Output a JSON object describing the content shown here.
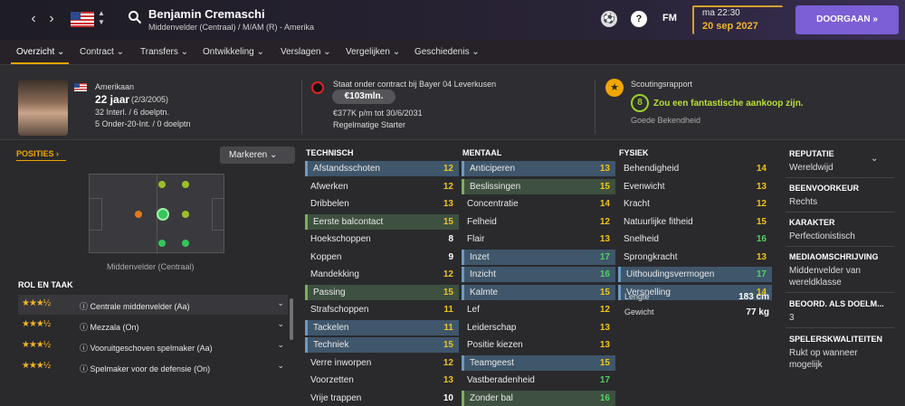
{
  "header": {
    "back_icon": "chevron-left-icon",
    "forward_icon": "chevron-right-icon",
    "player_name": "Benjamin Cremaschi",
    "player_sub": "Middenvelder (Centraal) / M/AM (R) - Amerika",
    "fm_label": "FM",
    "day_time": "ma 22:30",
    "date": "20 sep 2027",
    "continue_label": "DOORGAAN »",
    "help_label": "?"
  },
  "tabs": [
    "Overzicht ⌄",
    "Contract ⌄",
    "Transfers ⌄",
    "Ontwikkeling ⌄",
    "Verslagen ⌄",
    "Vergelijken ⌄",
    "Geschiedenis ⌄"
  ],
  "info": {
    "nationality": "Amerikaan",
    "age": "22 jaar",
    "dob": "(2/3/2005)",
    "caps": "32 Interl. / 6 doelptn.",
    "u20": "5 Onder-20-Int. / 0 doelptn",
    "contract_line": "Staat onder contract bij Bayer 04 Leverkusen",
    "value": "€103mln.",
    "wage": "€377K p/m tot 30/6/2031",
    "status": "Regelmatige Starter",
    "scout_title": "Scoutingsrapport",
    "scout_rating": "8",
    "scout_text": "Zou een fantastische aankoop zijn.",
    "scout_sub": "Goede Bekendheid"
  },
  "left": {
    "positions_label": "POSITIES ›",
    "mark_button": "Markeren ⌄",
    "pitch_caption": "Middenvelder (Centraal)",
    "role_header": "ROL EN TAAK",
    "roles": [
      {
        "stars": "★★★½",
        "name": "ⓘ Centrale middenvelder (Aa)"
      },
      {
        "stars": "★★★½",
        "name": "ⓘ Mezzala (On)"
      },
      {
        "stars": "★★★½",
        "name": "ⓘ Vooruitgeschoven spelmaker (Aa)"
      },
      {
        "stars": "★★★½",
        "name": "ⓘ Spelmaker voor de defensie (On)"
      }
    ]
  },
  "technisch": {
    "title": "TECHNISCH",
    "items": [
      {
        "name": "Afstandsschoten",
        "value": "12"
      },
      {
        "name": "Afwerken",
        "value": "12"
      },
      {
        "name": "Dribbelen",
        "value": "13"
      },
      {
        "name": "Eerste balcontact",
        "value": "15"
      },
      {
        "name": "Hoekschoppen",
        "value": "8"
      },
      {
        "name": "Koppen",
        "value": "9"
      },
      {
        "name": "Mandekking",
        "value": "12"
      },
      {
        "name": "Passing",
        "value": "15"
      },
      {
        "name": "Strafschoppen",
        "value": "11"
      },
      {
        "name": "Tackelen",
        "value": "11"
      },
      {
        "name": "Techniek",
        "value": "15"
      },
      {
        "name": "Verre inworpen",
        "value": "12"
      },
      {
        "name": "Voorzetten",
        "value": "13"
      },
      {
        "name": "Vrije trappen",
        "value": "10"
      }
    ]
  },
  "mentaal": {
    "title": "MENTAAL",
    "items": [
      {
        "name": "Anticiperen",
        "value": "13"
      },
      {
        "name": "Beslissingen",
        "value": "15"
      },
      {
        "name": "Concentratie",
        "value": "14"
      },
      {
        "name": "Felheid",
        "value": "12"
      },
      {
        "name": "Flair",
        "value": "13"
      },
      {
        "name": "Inzet",
        "value": "17"
      },
      {
        "name": "Inzicht",
        "value": "16"
      },
      {
        "name": "Kalmte",
        "value": "15"
      },
      {
        "name": "Lef",
        "value": "12"
      },
      {
        "name": "Leiderschap",
        "value": "13"
      },
      {
        "name": "Positie kiezen",
        "value": "13"
      },
      {
        "name": "Teamgeest",
        "value": "15"
      },
      {
        "name": "Vastberadenheid",
        "value": "17"
      },
      {
        "name": "Zonder bal",
        "value": "16"
      }
    ]
  },
  "fysiek": {
    "title": "FYSIEK",
    "items": [
      {
        "name": "Behendigheid",
        "value": "14"
      },
      {
        "name": "Evenwicht",
        "value": "13"
      },
      {
        "name": "Kracht",
        "value": "12"
      },
      {
        "name": "Natuurlijke fitheid",
        "value": "15"
      },
      {
        "name": "Snelheid",
        "value": "16"
      },
      {
        "name": "Sprongkracht",
        "value": "13"
      },
      {
        "name": "Uithoudingsvermogen",
        "value": "17"
      },
      {
        "name": "Versnelling",
        "value": "14"
      }
    ],
    "length_label": "Lengte",
    "length_value": "183 cm",
    "weight_label": "Gewicht",
    "weight_value": "77 kg"
  },
  "right": {
    "reputation_label": "REPUTATIE",
    "reputation_value": "Wereldwijd",
    "foot_label": "BEENVOORKEUR",
    "foot_value": "Rechts",
    "character_label": "KARAKTER",
    "character_value": "Perfectionistisch",
    "media_label": "MEDIAOMSCHRIJVING",
    "media_value1": "Middenvelder van",
    "media_value2": "wereldklasse",
    "gk_label": "BEOORD. ALS DOELM...",
    "gk_value": "3",
    "player_quality_label": "SPELERSKWALITEITEN",
    "player_quality_value1": "Rukt op wanneer",
    "player_quality_value2": "mogelijk"
  },
  "colors": {
    "accent": "#f0a500",
    "continue": "#7b5fd6",
    "highlight_blue": "#3f566b",
    "highlight_green": "#3e5040"
  }
}
